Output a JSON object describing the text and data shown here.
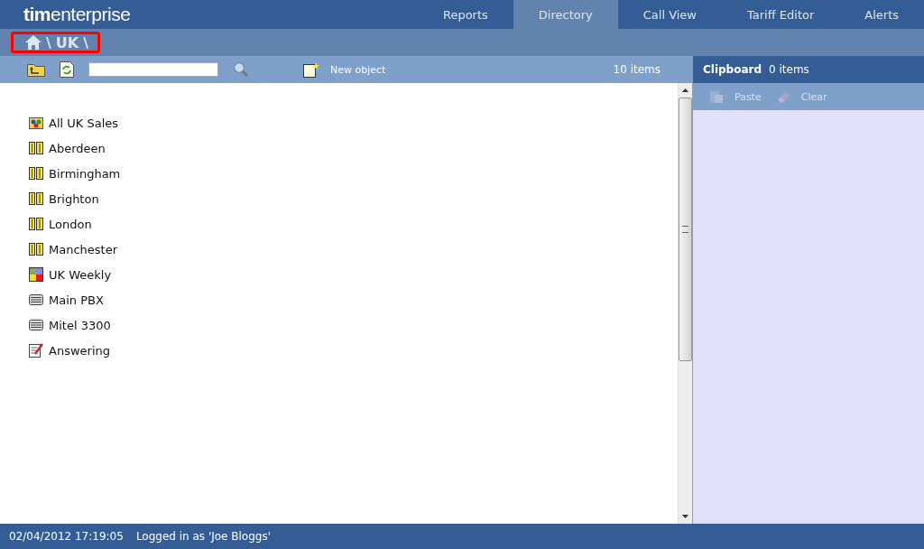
{
  "logo": "**tim**enterprise",
  "tabs": [
    {
      "label": "Reports",
      "selected": false
    },
    {
      "label": "Directory",
      "selected": true
    },
    {
      "label": "Call View",
      "selected": false
    },
    {
      "label": "Tariff Editor",
      "selected": false
    },
    {
      "label": "Alerts",
      "selected": false
    }
  ],
  "breadcrumb": {
    "items": [
      "\\",
      "UK",
      "\\"
    ]
  },
  "toolbar": {
    "new_object": "New object",
    "count": "10 items"
  },
  "items": [
    {
      "kind": "group",
      "label": "All UK Sales"
    },
    {
      "kind": "site",
      "label": "Aberdeen"
    },
    {
      "kind": "site",
      "label": "Birmingham"
    },
    {
      "kind": "site",
      "label": "Brighton"
    },
    {
      "kind": "site",
      "label": "London"
    },
    {
      "kind": "site",
      "label": "Manchester"
    },
    {
      "kind": "report",
      "label": "UK Weekly"
    },
    {
      "kind": "pbx",
      "label": "Main PBX"
    },
    {
      "kind": "pbx",
      "label": "Mitel 3300"
    },
    {
      "kind": "form",
      "label": "Answering"
    }
  ],
  "clipboard": {
    "title": "Clipboard",
    "count": "0 items",
    "buttons": [
      {
        "kind": "paste",
        "label": "Paste",
        "disabled": true
      },
      {
        "kind": "clear",
        "label": "Clear",
        "disabled": true
      }
    ]
  },
  "status_bar": {
    "datetime": "02/04/2012 17:19:05",
    "user": "Logged in as 'Joe Bloggs'"
  }
}
